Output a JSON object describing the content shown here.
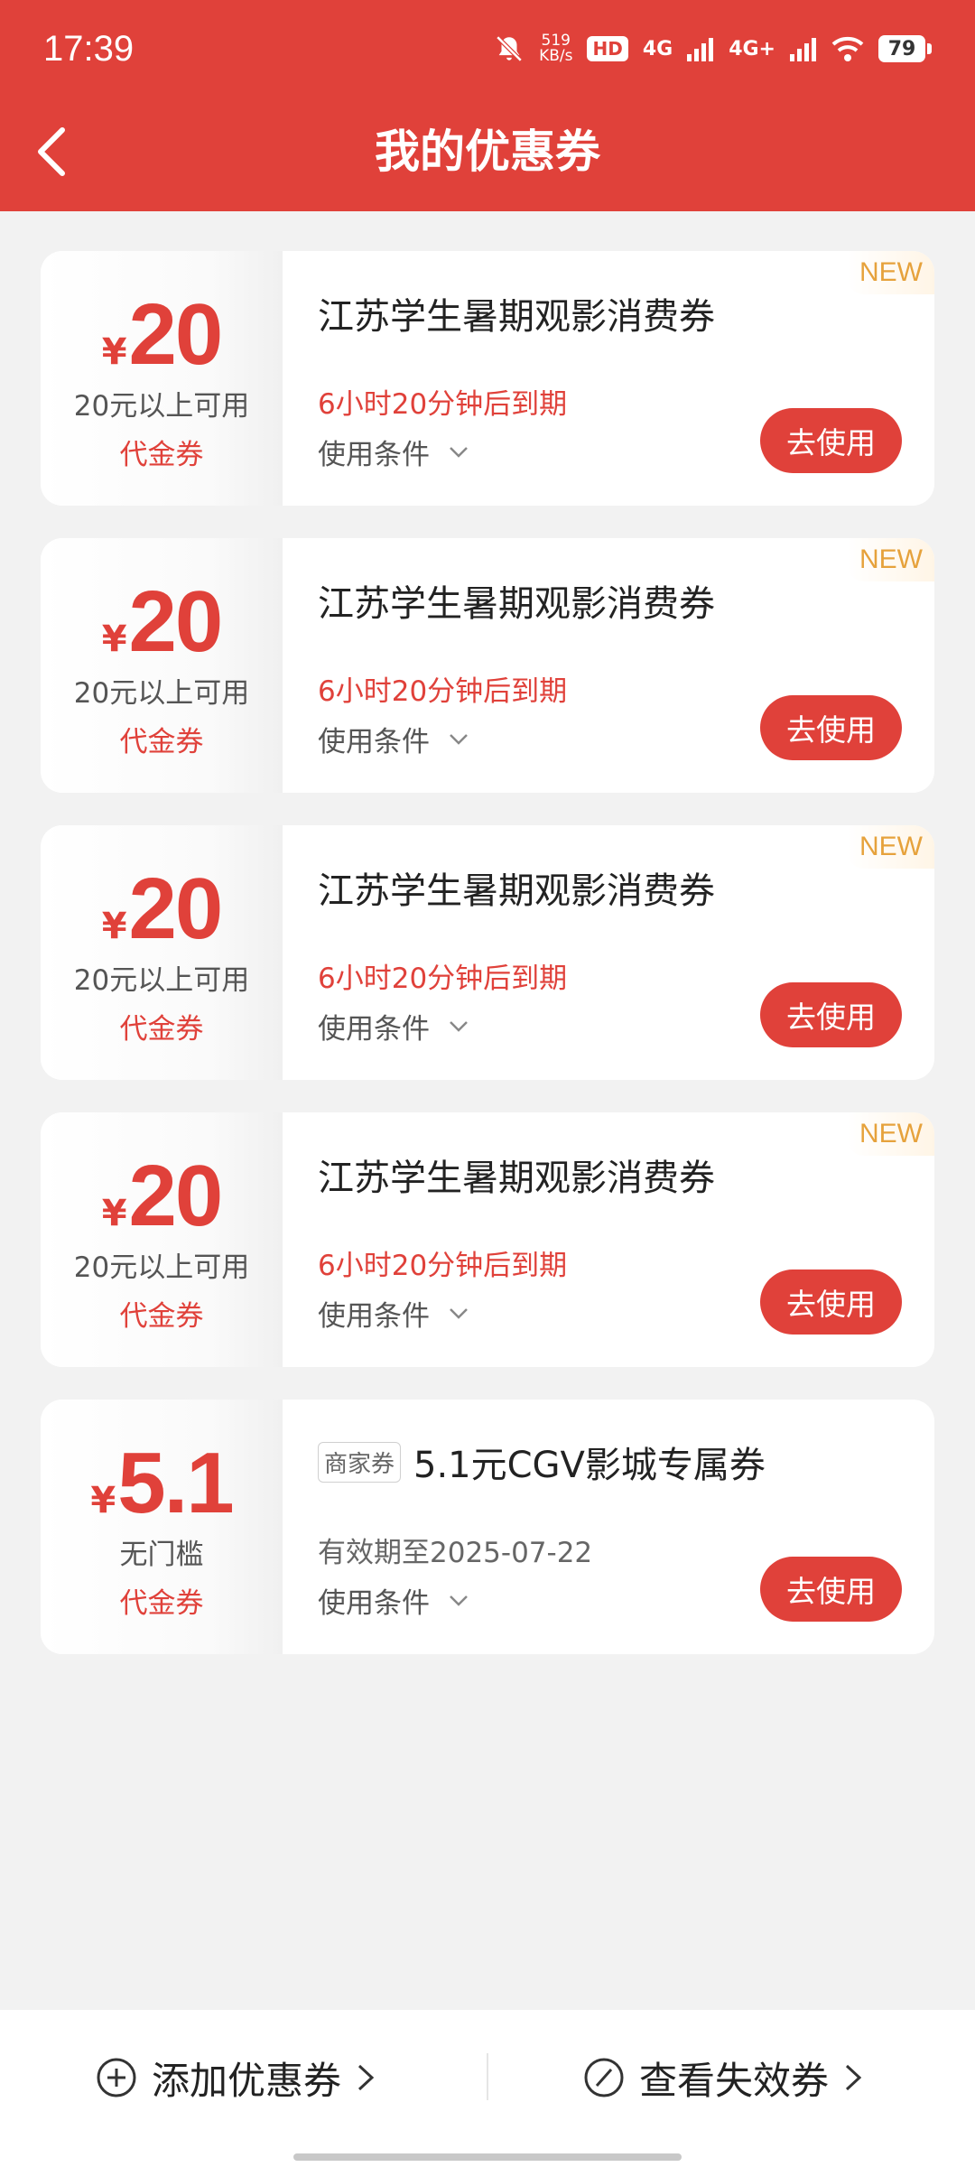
{
  "status_bar": {
    "time": "17:39",
    "net_speed_value": "519",
    "net_speed_unit": "KB/s",
    "hd": "HD",
    "signal1": "4G",
    "signal2": "4G+",
    "battery": "79"
  },
  "nav": {
    "title": "我的优惠券"
  },
  "coupons": [
    {
      "currency": "¥",
      "amount": "20",
      "threshold": "20元以上可用",
      "type": "代金券",
      "title": "江苏学生暑期观影消费券",
      "expiry": "6小时20分钟后到期",
      "conditions": "使用条件",
      "button": "去使用",
      "badge": "NEW"
    },
    {
      "currency": "¥",
      "amount": "20",
      "threshold": "20元以上可用",
      "type": "代金券",
      "title": "江苏学生暑期观影消费券",
      "expiry": "6小时20分钟后到期",
      "conditions": "使用条件",
      "button": "去使用",
      "badge": "NEW"
    },
    {
      "currency": "¥",
      "amount": "20",
      "threshold": "20元以上可用",
      "type": "代金券",
      "title": "江苏学生暑期观影消费券",
      "expiry": "6小时20分钟后到期",
      "conditions": "使用条件",
      "button": "去使用",
      "badge": "NEW"
    },
    {
      "currency": "¥",
      "amount": "20",
      "threshold": "20元以上可用",
      "type": "代金券",
      "title": "江苏学生暑期观影消费券",
      "expiry": "6小时20分钟后到期",
      "conditions": "使用条件",
      "button": "去使用",
      "badge": "NEW"
    },
    {
      "currency": "¥",
      "amount": "5.1",
      "threshold": "无门槛",
      "type": "代金券",
      "tag": "商家券",
      "title": "5.1元CGV影城专属券",
      "expiry": "有效期至2025-07-22",
      "conditions": "使用条件",
      "button": "去使用"
    }
  ],
  "footer": {
    "add_label": "添加优惠券",
    "expired_label": "查看失效券"
  },
  "colors": {
    "brand": "#e0413a",
    "badge": "#e6a23c",
    "background": "#f2f2f2"
  },
  "icons": {
    "back": "chevron-left-icon",
    "conditions": "chevron-down-icon",
    "add": "plus-circle-icon",
    "expired": "slash-circle-icon",
    "footer_arrow": "chevron-right-icon"
  }
}
